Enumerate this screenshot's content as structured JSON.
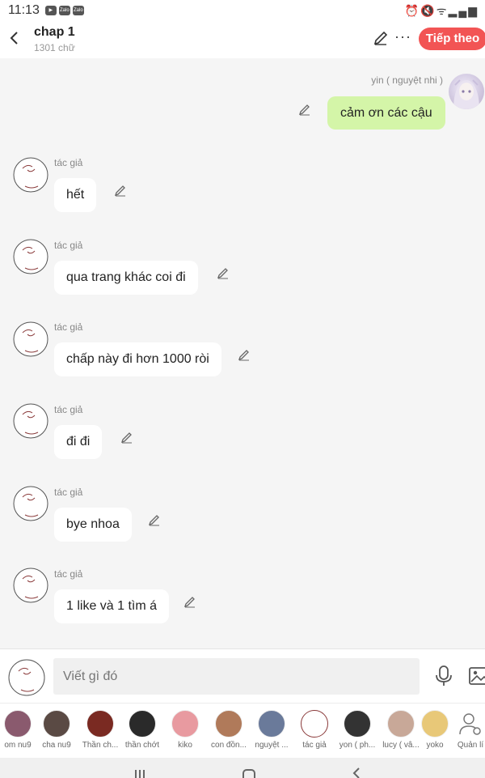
{
  "status_bar": {
    "time": "11:13",
    "app_icons": [
      "youtube-icon",
      "zalo-icon",
      "zalo-icon"
    ],
    "right_icons": [
      "alarm-icon",
      "mute-icon",
      "wifi-icon",
      "signal-icon"
    ]
  },
  "header": {
    "title": "chap 1",
    "word_count": "1301 chữ",
    "next_label": "Tiếp theo"
  },
  "my_message": {
    "sender": "yin ( nguyệt nhi )",
    "text": "cảm ơn các cậu"
  },
  "messages": [
    {
      "author": "tác giả",
      "text": "hết"
    },
    {
      "author": "tác giả",
      "text": "qua trang khác coi đi"
    },
    {
      "author": "tác giả",
      "text": "chấp này đi hơn 1000 ròi"
    },
    {
      "author": "tác giả",
      "text": "đi đi"
    },
    {
      "author": "tác giả",
      "text": "bye nhoa"
    },
    {
      "author": "tác giả",
      "text": "1 like và 1 tìm á"
    }
  ],
  "composer": {
    "placeholder": "Viết gì đó"
  },
  "characters": [
    {
      "name": "om nu9",
      "color": "#8a5a6e"
    },
    {
      "name": "cha nu9",
      "color": "#5a4a44"
    },
    {
      "name": "Thần ch...",
      "color": "#7a2a22"
    },
    {
      "name": "thần chớt",
      "color": "#2a2a2a"
    },
    {
      "name": "kiko",
      "color": "#e89aa0"
    },
    {
      "name": "con đồn...",
      "color": "#b07a5a"
    },
    {
      "name": "nguyệt ...",
      "color": "#6a7a9a"
    },
    {
      "name": "tác giả",
      "color": "#ffffff"
    },
    {
      "name": "yon ( ph...",
      "color": "#333333"
    },
    {
      "name": "lucy ( vâ...",
      "color": "#c8a898"
    },
    {
      "name": "yoko",
      "color": "#e8c878"
    },
    {
      "name": "Quản lí",
      "color": "#ffffff"
    }
  ],
  "colors": {
    "accent": "#f25454",
    "my_bubble": "#d4f5a8",
    "other_bubble": "#ffffff",
    "background": "#f5f5f5"
  }
}
